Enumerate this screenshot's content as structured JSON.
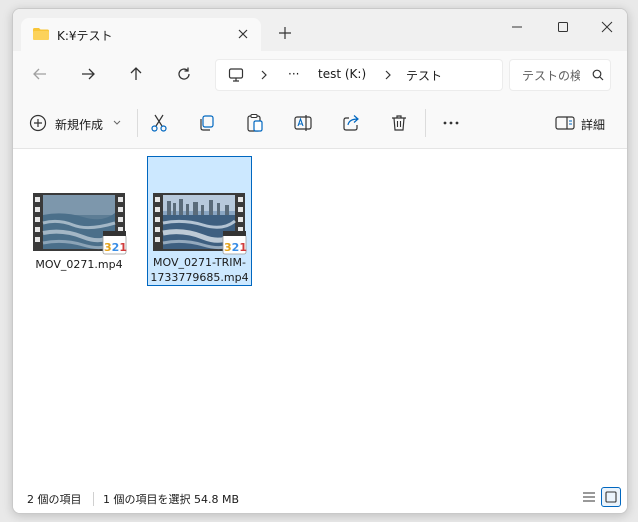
{
  "window": {
    "tab_title": "K:¥テスト",
    "new_tab_symbol": "+"
  },
  "address_bar": {
    "overflow": "···",
    "drive": "test (K:)",
    "folder": "テスト"
  },
  "search": {
    "placeholder": "テストの検索"
  },
  "toolbar": {
    "new_label": "新規作成",
    "more_label": "···",
    "details_label": "詳細"
  },
  "files": [
    {
      "name_line1": "MOV_0271.mp4",
      "name_line2": "",
      "selected": false
    },
    {
      "name_line1": "MOV_0271-TRIM-",
      "name_line2": "1733779685.mp4",
      "selected": true
    }
  ],
  "status": {
    "item_count": "2 個の項目",
    "selection": "1 個の項目を選択  54.8 MB"
  },
  "colors": {
    "accent": "#0067c0",
    "selection_bg": "#cce8ff",
    "folder_yellow": "#f8c537"
  }
}
